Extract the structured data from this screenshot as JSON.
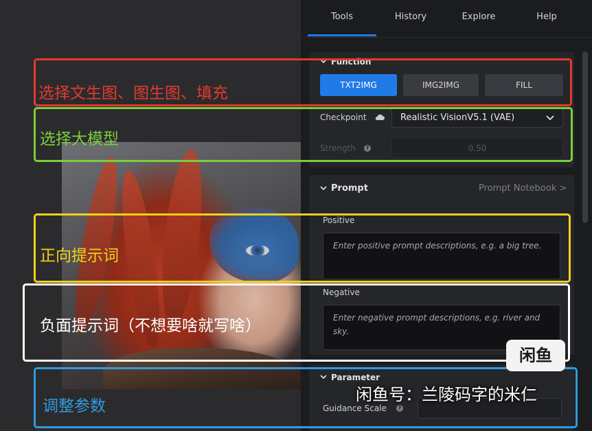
{
  "tabs": [
    "Tools",
    "History",
    "Explore",
    "Help"
  ],
  "function_section": {
    "title": "Function",
    "buttons": [
      "TXT2IMG",
      "IMG2IMG",
      "FILL"
    ]
  },
  "checkpoint": {
    "label": "Checkpoint",
    "value": "Realistic VisionV5.1 (VAE)"
  },
  "strength": {
    "label": "Strength",
    "value": "0.50"
  },
  "prompt_section": {
    "title": "Prompt",
    "notebook_link": "Prompt Notebook >",
    "positive_label": "Positive",
    "positive_placeholder": "Enter positive prompt descriptions, e.g. a big tree.",
    "negative_label": "Negative",
    "negative_placeholder": "Enter negative prompt descriptions, e.g. river and sky."
  },
  "parameter_section": {
    "title": "Parameter",
    "guidance_label": "Guidance Scale"
  },
  "annotations": [
    {
      "text": "选择文生图、图生图、填充",
      "color": "#e53a2e"
    },
    {
      "text": "选择大模型",
      "color": "#7ccf3a"
    },
    {
      "text": "正向提示词",
      "color": "#f2d21b"
    },
    {
      "text": "负面提示词（不想要啥就写啥）",
      "color": "#ffffff"
    },
    {
      "text": "调整参数",
      "color": "#2f9be0"
    }
  ],
  "watermark": {
    "badge": "闲鱼",
    "text": "闲鱼号：兰陵码字的米仁"
  }
}
